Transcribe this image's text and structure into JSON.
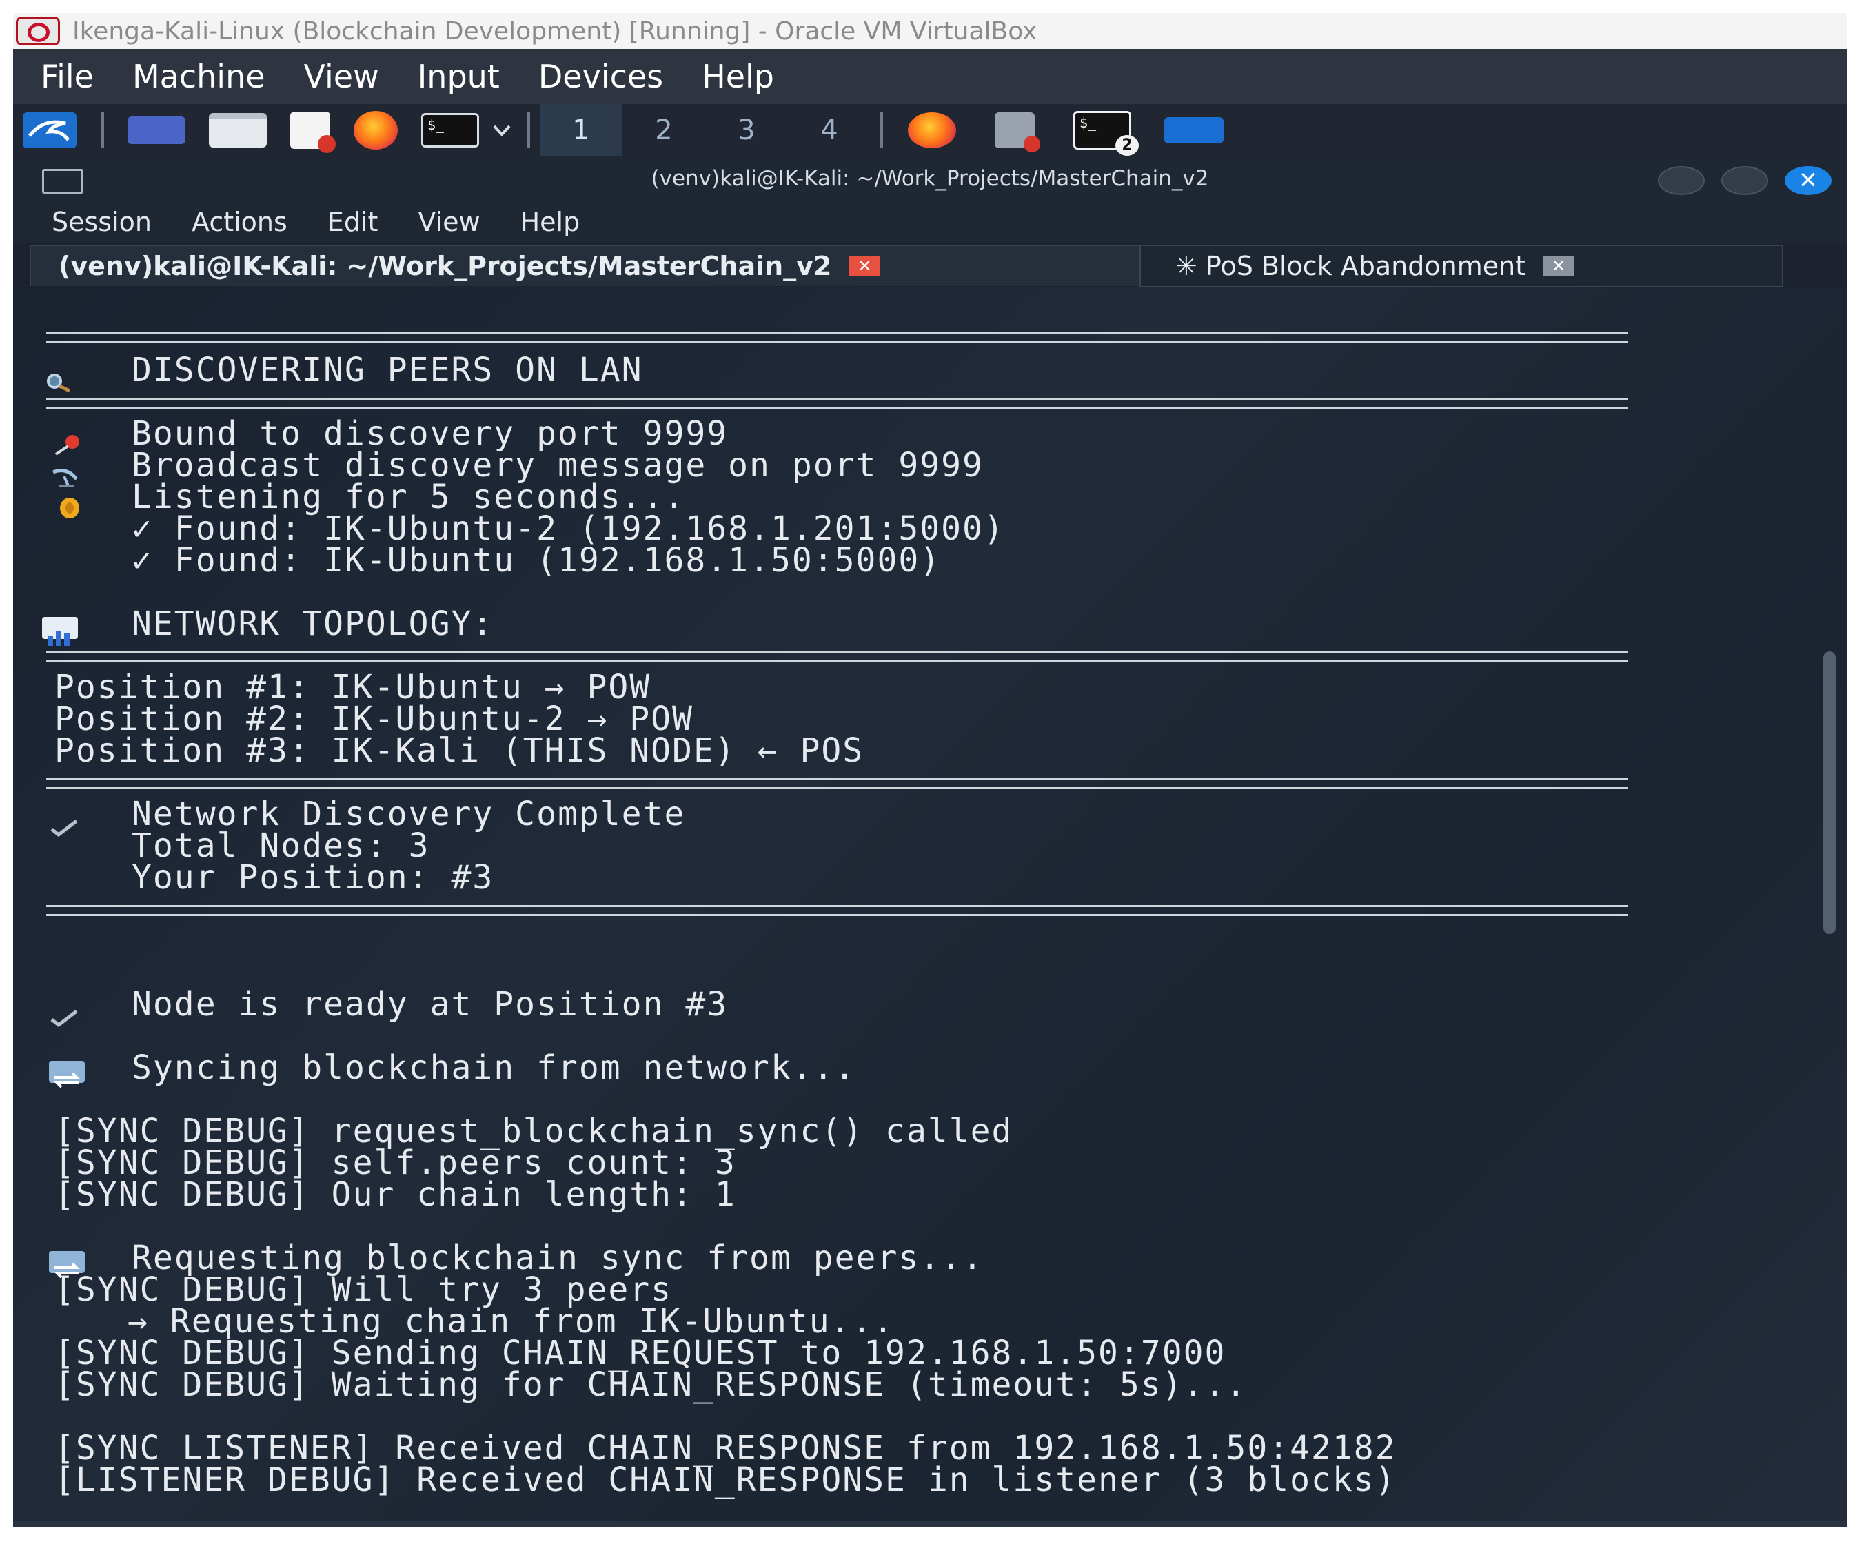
{
  "vbox": {
    "title": "Ikenga-Kali-Linux (Blockchain Development) [Running] - Oracle VM VirtualBox",
    "menu": [
      "File",
      "Machine",
      "View",
      "Input",
      "Devices",
      "Help"
    ]
  },
  "taskbar": {
    "workspaces": [
      "1",
      "2",
      "3",
      "4"
    ],
    "terminal_badge": "2"
  },
  "konsole": {
    "title": "(venv)kali@IK-Kali: ~/Work_Projects/MasterChain_v2",
    "menu": [
      "Session",
      "Actions",
      "Edit",
      "View",
      "Help"
    ],
    "tabs": [
      {
        "label": "(venv)kali@IK-Kali: ~/Work_Projects/MasterChain_v2"
      },
      {
        "label": "✳ PoS Block Abandonment"
      }
    ]
  },
  "terminal": {
    "discover_header": "DISCOVERING PEERS ON LAN",
    "bound": "Bound to discovery port 9999",
    "broadcast": "Broadcast discovery message on port 9999",
    "listening": "Listening for 5 seconds...",
    "found1": "✓ Found: IK-Ubuntu-2 (192.168.1.201:5000)",
    "found2": "✓ Found: IK-Ubuntu (192.168.1.50:5000)",
    "topology_header": "NETWORK TOPOLOGY:",
    "pos1": "Position #1: IK-Ubuntu → POW",
    "pos2": "Position #2: IK-Ubuntu-2 → POW",
    "pos3": "Position #3: IK-Kali (THIS NODE) ← POS",
    "complete": "Network Discovery Complete",
    "total_nodes": "Total Nodes: 3",
    "your_position": "Your Position: #3",
    "ready": "Node is ready at Position #3",
    "syncing": "Syncing blockchain from network...",
    "debug1": "[SYNC DEBUG] request_blockchain_sync() called",
    "debug2": "[SYNC DEBUG] self.peers count: 3",
    "debug3": "[SYNC DEBUG] Our chain length: 1",
    "requesting": "Requesting blockchain sync from peers...",
    "debug4": "[SYNC DEBUG] Will try 3 peers",
    "requesting_chain": "→ Requesting chain from IK-Ubuntu...",
    "debug5": "[SYNC DEBUG] Sending CHAIN_REQUEST to 192.168.1.50:7000",
    "debug6": "[SYNC DEBUG] Waiting for CHAIN_RESPONSE (timeout: 5s)...",
    "listener1": "[SYNC LISTENER] Received CHAIN_RESPONSE from 192.168.1.50:42182",
    "listener2": "[LISTENER DEBUG] Received CHAIN_RESPONSE in listener (3 blocks)"
  },
  "colors": {
    "terminal_bg": "#1b2330",
    "terminal_fg": "#e6e9ee",
    "close_button": "#1a84e6",
    "tab_close": "#e8513f"
  },
  "icons": {
    "search": "magnifier-icon",
    "pin": "pushpin-icon",
    "satellite": "satellite-antenna-icon",
    "ear": "ear-icon",
    "chart": "bar-chart-icon",
    "check": "check-mark-icon",
    "sync": "sync-arrows-icon"
  }
}
